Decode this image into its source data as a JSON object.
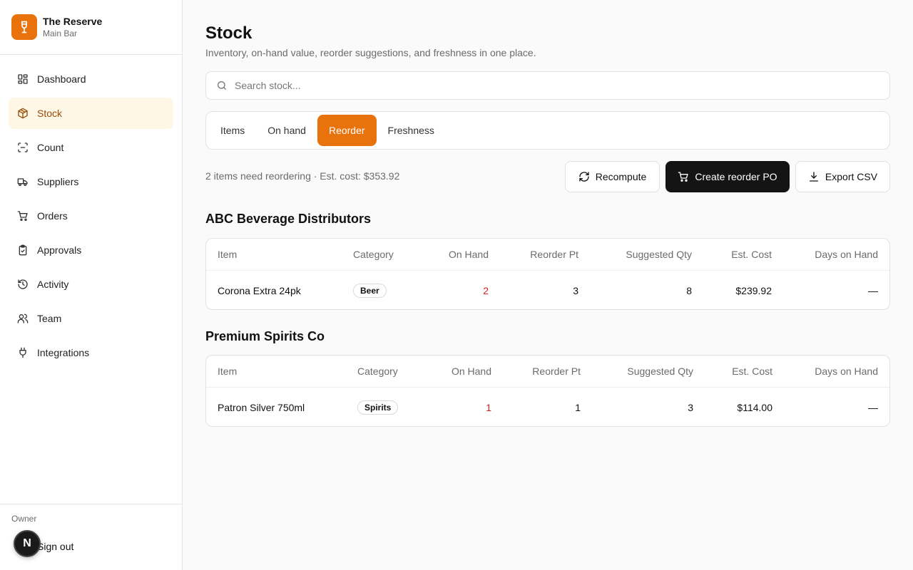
{
  "brand": {
    "name": "The Reserve",
    "location": "Main Bar",
    "accent": "#e8730c"
  },
  "nav": [
    {
      "label": "Dashboard",
      "icon": "dashboard-icon",
      "active": false
    },
    {
      "label": "Stock",
      "icon": "box-icon",
      "active": true
    },
    {
      "label": "Count",
      "icon": "scan-icon",
      "active": false
    },
    {
      "label": "Suppliers",
      "icon": "truck-icon",
      "active": false
    },
    {
      "label": "Orders",
      "icon": "cart-icon",
      "active": false
    },
    {
      "label": "Approvals",
      "icon": "clipboard-check-icon",
      "active": false
    },
    {
      "label": "Activity",
      "icon": "history-icon",
      "active": false
    },
    {
      "label": "Team",
      "icon": "users-icon",
      "active": false
    },
    {
      "label": "Integrations",
      "icon": "plug-icon",
      "active": false
    }
  ],
  "footer": {
    "role": "Owner",
    "signout": "Sign out",
    "avatar_initial": "N"
  },
  "page": {
    "title": "Stock",
    "subtitle": "Inventory, on-hand value, reorder suggestions, and freshness in one place."
  },
  "search": {
    "placeholder": "Search stock...",
    "value": ""
  },
  "tabs": [
    {
      "label": "Items",
      "active": false
    },
    {
      "label": "On hand",
      "active": false
    },
    {
      "label": "Reorder",
      "active": true
    },
    {
      "label": "Freshness",
      "active": false
    }
  ],
  "summary": "2 items need reordering · Est. cost: $353.92",
  "actions": {
    "recompute": "Recompute",
    "create_po": "Create reorder PO",
    "export": "Export CSV"
  },
  "columns": [
    "Item",
    "Category",
    "On Hand",
    "Reorder Pt",
    "Suggested Qty",
    "Est. Cost",
    "Days on Hand"
  ],
  "groups": [
    {
      "supplier": "ABC Beverage Distributors",
      "rows": [
        {
          "item": "Corona Extra 24pk",
          "category": "Beer",
          "on_hand": "2",
          "reorder_pt": "3",
          "suggested_qty": "8",
          "est_cost": "$239.92",
          "days_on_hand": "—"
        }
      ]
    },
    {
      "supplier": "Premium Spirits Co",
      "rows": [
        {
          "item": "Patron Silver 750ml",
          "category": "Spirits",
          "on_hand": "1",
          "reorder_pt": "1",
          "suggested_qty": "3",
          "est_cost": "$114.00",
          "days_on_hand": "—"
        }
      ]
    }
  ]
}
